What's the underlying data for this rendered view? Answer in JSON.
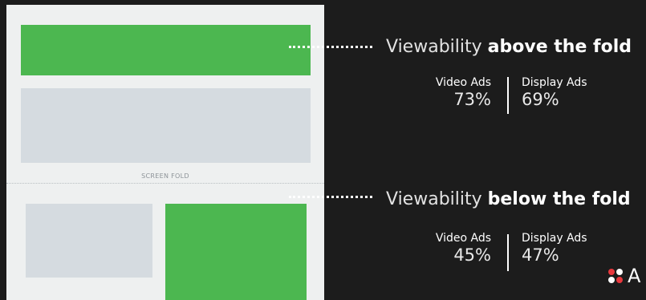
{
  "mockup": {
    "fold_label": "SCREEN FOLD"
  },
  "above": {
    "heading_prefix": "Viewability",
    "heading_bold": "above the fold",
    "video_label": "Video Ads",
    "video_value": "73%",
    "display_label": "Display Ads",
    "display_value": "69%"
  },
  "below": {
    "heading_prefix": "Viewability",
    "heading_bold": "below the fold",
    "video_label": "Video Ads",
    "video_value": "45%",
    "display_label": "Display Ads",
    "display_value": "47%"
  },
  "logo": {
    "text": "A",
    "icon": "four-dot-logo-icon"
  },
  "colors": {
    "background": "#1c1c1c",
    "ad_green": "#4cb750",
    "placeholder_gray": "#d5dbe0",
    "page_bg": "#eef0f0",
    "logo_red": "#e8383d"
  }
}
